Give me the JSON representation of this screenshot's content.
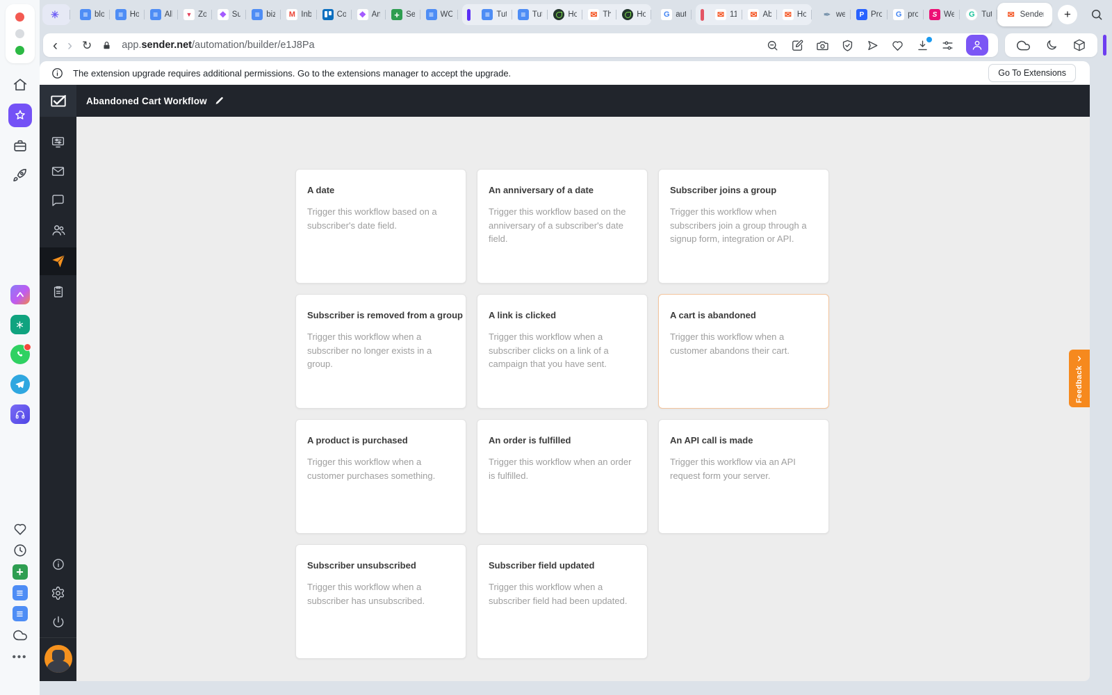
{
  "colors": {
    "accent_orange": "#F6891E",
    "accent_purple": "#7452F6",
    "highlight_card_border": "#F3C49C",
    "header_dark": "#21252C"
  },
  "browser": {
    "tabs": [
      {
        "icon": "pin-star",
        "label": "",
        "state": "pinned"
      },
      {
        "icon": "docs",
        "label": "blo"
      },
      {
        "icon": "docs",
        "label": "Ho"
      },
      {
        "icon": "docs",
        "label": "All"
      },
      {
        "icon": "funnel",
        "label": "Zo"
      },
      {
        "icon": "figma",
        "label": "Su"
      },
      {
        "icon": "docs",
        "label": "biz"
      },
      {
        "icon": "gmail",
        "label": "Inb"
      },
      {
        "icon": "trello",
        "label": "Co"
      },
      {
        "icon": "figma",
        "label": "An"
      },
      {
        "icon": "plus-green",
        "label": "Se"
      },
      {
        "icon": "docs",
        "label": "WC"
      },
      {
        "icon": "bar-purple",
        "label": "",
        "state": "group-bar grp grp-start"
      },
      {
        "icon": "docs",
        "label": "Tut",
        "state": "grp"
      },
      {
        "icon": "docs",
        "label": "Tut",
        "state": "grp"
      },
      {
        "icon": "leaf-dark",
        "label": "Ho",
        "state": "grp"
      },
      {
        "icon": "mail-orange",
        "label": "Th",
        "state": "grp"
      },
      {
        "icon": "leaf-dark",
        "label": "Ho",
        "state": "grp grp-end"
      },
      {
        "icon": "google",
        "label": "aut"
      },
      {
        "icon": "bar-red",
        "label": "",
        "state": "group-bar grp grp-start"
      },
      {
        "icon": "mail-orange",
        "label": "11",
        "state": "grp"
      },
      {
        "icon": "mail-orange",
        "label": "Ab",
        "state": "grp"
      },
      {
        "icon": "mail-orange",
        "label": "Ho",
        "state": "grp grp-end"
      },
      {
        "icon": "feather",
        "label": "we"
      },
      {
        "icon": "p-blue",
        "label": "Pro"
      },
      {
        "icon": "google",
        "label": "pro"
      },
      {
        "icon": "s-pink",
        "label": "We"
      },
      {
        "icon": "g-green",
        "label": "Tut"
      },
      {
        "icon": "mail-orange",
        "label": "Sender",
        "state": "active"
      }
    ],
    "new_tab_label": "+",
    "address": {
      "prefix": "app.",
      "domain": "sender.net",
      "path": "/automation/builder/e1J8Pa"
    },
    "toolbar_icons": [
      "zoom-out",
      "compose",
      "camera",
      "shield-check",
      "send",
      "heart",
      "download",
      "sliders",
      "profile"
    ],
    "extension_icons": [
      "cloud",
      "moon",
      "cube"
    ]
  },
  "notification": {
    "message": "The extension upgrade requires additional permissions. Go to the extensions manager to accept the upgrade.",
    "button_label": "Go To Extensions"
  },
  "app": {
    "title": "Abandoned Cart Workflow",
    "feedback_label": "Feedback",
    "sidebar_icons": [
      "dashboard",
      "campaigns-mail",
      "chat",
      "subscribers",
      "automation",
      "forms"
    ],
    "sidebar_footer_icons": [
      "info",
      "settings",
      "power"
    ]
  },
  "cards": [
    {
      "title": "A date",
      "desc": "Trigger this workflow based on a subscriber's date field."
    },
    {
      "title": "An anniversary of a date",
      "desc": "Trigger this workflow based on the anniversary of a subscriber's date field."
    },
    {
      "title": "Subscriber joins a group",
      "desc": "Trigger this workflow when subscribers join a group through a signup form, integration or API."
    },
    {
      "title": "Subscriber is removed from a group",
      "desc": "Trigger this workflow when a subscriber no longer exists in a group."
    },
    {
      "title": "A link is clicked",
      "desc": "Trigger this workflow when a subscriber clicks on a link of a campaign that you have sent."
    },
    {
      "title": "A cart is abandoned",
      "desc": "Trigger this workflow when a customer abandons their cart.",
      "state": "highlight"
    },
    {
      "title": "A product is purchased",
      "desc": "Trigger this workflow when a customer purchases something."
    },
    {
      "title": "An order is fulfilled",
      "desc": "Trigger this workflow when an order is fulfilled."
    },
    {
      "title": "An API call is made",
      "desc": "Trigger this workflow via an API request form your server."
    },
    {
      "title": "Subscriber unsubscribed",
      "desc": "Trigger this workflow when a subscriber has unsubscribed."
    },
    {
      "title": "Subscriber field updated",
      "desc": "Trigger this workflow when a subscriber field had been updated."
    }
  ]
}
